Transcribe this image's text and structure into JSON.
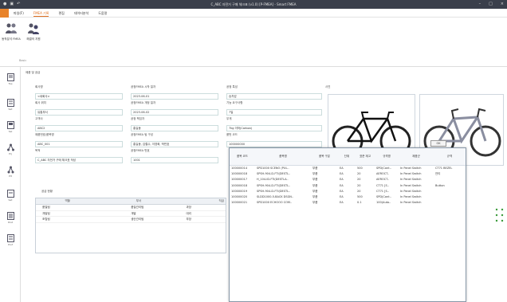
{
  "window": {
    "title": "C_ABC 자전거 구매 체크표 (v1.0) [P-FMEA] - Smart FMEA"
  },
  "menu": {
    "tabs": [
      "파일(F)",
      "FMEA 기록",
      "편집",
      "데이터분석",
      "도움말"
    ],
    "active_index": 1
  },
  "ribbon": {
    "buttons": [
      {
        "label": "동작분석 FMEA"
      },
      {
        "label": "해결의 지원"
      }
    ],
    "group_label": "Basic"
  },
  "sidenav": {
    "items": [
      {
        "label": "Top"
      },
      {
        "label": "Set"
      },
      {
        "label": "Sel"
      },
      {
        "label": "Prj"
      },
      {
        "label": "Plt"
      },
      {
        "label": "Sat"
      },
      {
        "label": "Dist"
      },
      {
        "label": "Prof"
      }
    ]
  },
  "form": {
    "section_title": "제품 및 공급",
    "left_fields": [
      {
        "label": "회사명",
        "value": "<새회사>"
      },
      {
        "label": "회사 위치",
        "value": "유통부서"
      },
      {
        "label": "고객사",
        "value": "ABC2"
      },
      {
        "label": "제품번호/품목명",
        "value": "ABC_001"
      },
      {
        "label": "목적",
        "value": "C_ABC 자전거 구매 체크표 작성"
      }
    ],
    "mid_fields": [
      {
        "label": "공정FMEA 시작 일자",
        "value": "2023-06-01"
      },
      {
        "label": "공정FMEA 개정 일자",
        "value": "2023-06-02"
      },
      {
        "label": "공정 책임자",
        "value": "홍길동"
      },
      {
        "label": "공정FMEA 팀 구성",
        "value": "홍길동, 김철수, 이영희, 박민호"
      },
      {
        "label": "공정FMEA 번호",
        "value": "1001"
      }
    ],
    "right_fields": [
      {
        "label": "공정 특성",
        "value": "승차감"
      },
      {
        "label": "기능 요구사항",
        "value": "7일"
      },
      {
        "label": "무게",
        "value": "7kg 이하(Carbon)"
      },
      {
        "label": "품번 코드",
        "value": "100000000"
      }
    ],
    "image_caption": "사진"
  },
  "lower": {
    "section_title": "공급 현황",
    "columns": [
      "역할",
      "부서",
      "직급"
    ],
    "rows": [
      [
        "품질팀",
        "품질관리팀",
        "과장"
      ],
      [
        "개발팀",
        "개발",
        "대리"
      ],
      [
        "조립팀",
        "생산관리팀",
        "부장"
      ]
    ]
  },
  "popup": {
    "ok_label": "OK",
    "columns": [
      "품목 코드",
      "품목명",
      "품목 구분",
      "단위",
      "표준 재고",
      "규격명",
      "제품군",
      "규격"
    ],
    "rows": [
      [
        "100000014",
        "SPD1000 SCENO (PUL..",
        "부품",
        "EA",
        "500",
        "SPD(Cont..",
        "In Panel Switch",
        "CT71 BEZEL"
      ],
      [
        "100000018",
        "SPSH-904-D-FTI(DESTL..",
        "부품",
        "EA",
        "20",
        "AEROCT..",
        "In Panel Switch",
        "안티"
      ],
      [
        "100000017",
        "H_104-ID-FTI(DESTLA..",
        "부품",
        "EA",
        "20",
        "AEROCT..",
        "In Panel Switch",
        ""
      ],
      [
        "100000018",
        "SPSH-904-D-FTI(DESTL..",
        "부품",
        "EA",
        "20",
        "CT71 [S..",
        "In Panel Switch",
        "Button"
      ],
      [
        "100000019",
        "SPSH-904-D-FTI(DESTL..",
        "부품",
        "EA",
        "20",
        "CT71 [S..",
        "In Panel Switch",
        ""
      ],
      [
        "100000020",
        "SLDD1000-5-BACK DSGN..",
        "부품",
        "EA",
        "500",
        "SPD(Cont..",
        "In Panel Switch",
        ""
      ],
      [
        "100000021",
        "SPD1000 ECHOOO COM..",
        "부품",
        "EA",
        "0.1",
        "100(Auto..",
        "In Panel Switch",
        ""
      ]
    ]
  },
  "colors": {
    "accent": "#e8832a",
    "titlebar": "#3a3f4b",
    "required": "#e06020"
  }
}
